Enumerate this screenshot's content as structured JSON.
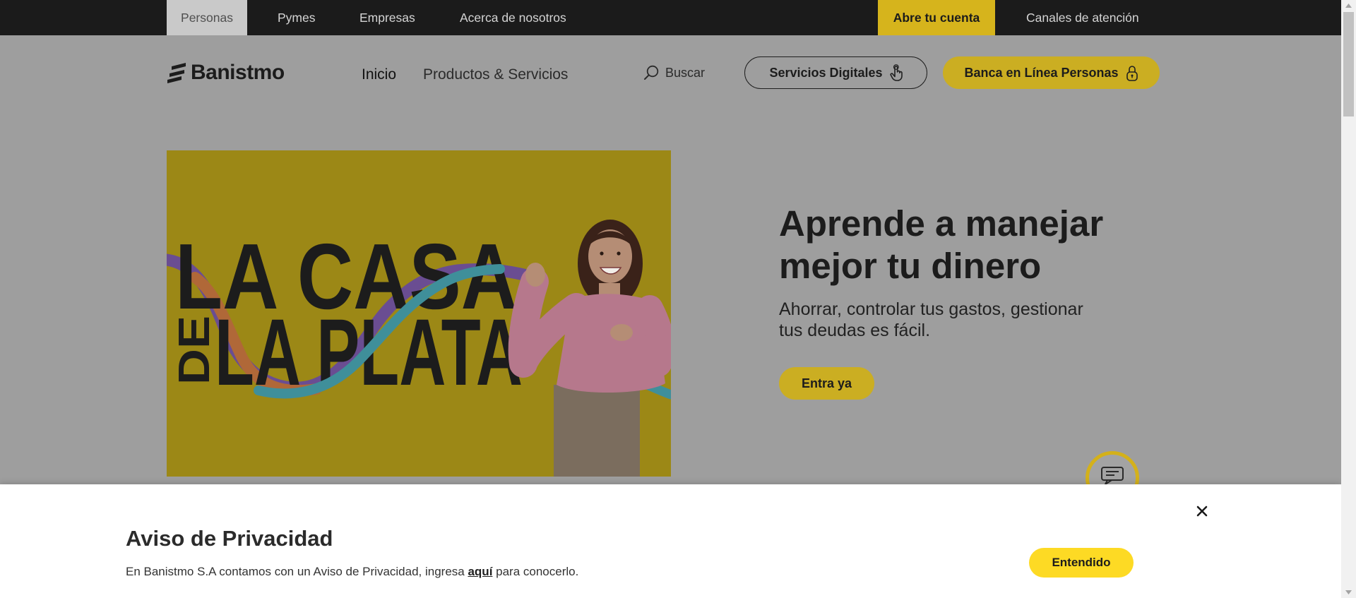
{
  "topbar": {
    "segments": [
      {
        "label": "Personas",
        "active": true
      },
      {
        "label": "Pymes",
        "active": false
      },
      {
        "label": "Empresas",
        "active": false
      },
      {
        "label": "Acerca de nosotros",
        "active": false
      }
    ],
    "open_account": "Abre tu cuenta",
    "contact_channels": "Canales de atención"
  },
  "header": {
    "logo_text": "Banistmo",
    "nav": [
      {
        "label": "Inicio",
        "active": true
      },
      {
        "label": "Productos & Servicios",
        "active": false
      }
    ],
    "search_label": "Buscar",
    "digital_services_button": "Servicios Digitales",
    "online_banking_button": "Banca en Línea Personas"
  },
  "hero": {
    "artwork_text": {
      "line1": "LA CASA",
      "line2_prefix": "DE",
      "line2": "LA PLATA"
    },
    "title": "Aprende a manejar mejor tu dinero",
    "subtitle": "Ahorrar, controlar tus gastos, gestionar tus deudas es fácil.",
    "cta_button": "Entra ya"
  },
  "privacy_banner": {
    "title": "Aviso de Privacidad",
    "text_before_link": "En Banistmo S.A contamos con un Aviso de Privacidad, ingresa ",
    "link_text": "aquí",
    "text_after_link": " para conocerlo.",
    "accept_button": "Entendido"
  },
  "icons": {
    "logo": "banistmo-logo-mark",
    "search": "search-icon",
    "digital_services": "hand-pointer-icon",
    "online_banking": "lock-icon",
    "chat": "chat-icon",
    "close": "close-icon"
  },
  "colors": {
    "brand_yellow": "#fdda24",
    "topbar_background": "#1b1b1b",
    "dimmed_page_background": "#9e9e9e",
    "text_dark": "#1f1f1f"
  }
}
